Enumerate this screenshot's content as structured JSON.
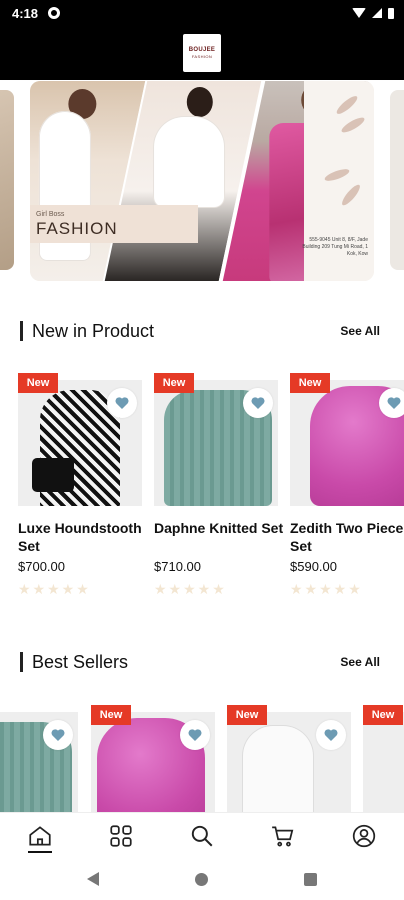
{
  "status": {
    "time": "4:18"
  },
  "brand": {
    "logo_top": "BOUJEE",
    "logo_bottom": "FASHION"
  },
  "banner": {
    "small": "Girl Boss",
    "title": "FASHION",
    "contact": "555-9045 Unit 8, 8/F, Jade Building 209 Tung Mi Road, 1 Kok, Kow"
  },
  "new_in": {
    "title": "New in Product",
    "see_all": "See All",
    "products": [
      {
        "badge": "New",
        "name": "Luxe Houndstooth Set",
        "price": "$700.00",
        "rating": 0,
        "image": "houndstooth"
      },
      {
        "badge": "New",
        "name": "Daphne Knitted Set",
        "price": "$710.00",
        "rating": 0,
        "image": "knit"
      },
      {
        "badge": "New",
        "name": "Zedith Two Piece Set",
        "price": "$590.00",
        "rating": 0,
        "image": "pink"
      }
    ]
  },
  "best_sellers": {
    "title": "Best Sellers",
    "see_all": "See All",
    "products": [
      {
        "badge": "",
        "image": "knit"
      },
      {
        "badge": "New",
        "image": "pink"
      },
      {
        "badge": "New",
        "image": "white"
      },
      {
        "badge": "New",
        "image": "curtain"
      }
    ]
  },
  "nav": {
    "items": [
      "home-icon",
      "categories-icon",
      "search-icon",
      "cart-icon",
      "profile-icon"
    ],
    "active": "home"
  },
  "colors": {
    "accent": "#e53a26",
    "header": "#000000",
    "heart": "#6d9bb3"
  }
}
